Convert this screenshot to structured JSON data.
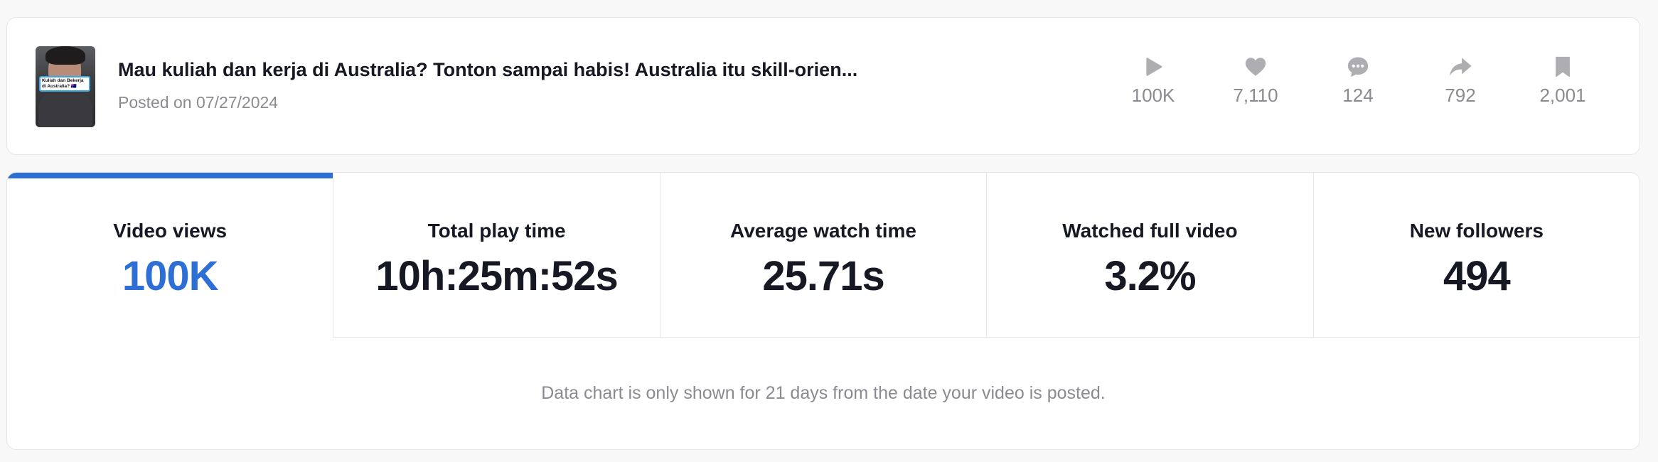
{
  "video": {
    "title": "Mau kuliah dan kerja di Australia? Tonton sampai habis! Australia itu skill-orien...",
    "posted": "Posted on 07/27/2024",
    "thumbnail_caption": "Kuliah dan Bekerja di Australia? 🇦🇺",
    "stats": [
      {
        "icon": "play-icon",
        "value": "100K"
      },
      {
        "icon": "heart-icon",
        "value": "7,110"
      },
      {
        "icon": "comment-icon",
        "value": "124"
      },
      {
        "icon": "share-icon",
        "value": "792"
      },
      {
        "icon": "bookmark-icon",
        "value": "2,001"
      }
    ]
  },
  "metrics": [
    {
      "label": "Video views",
      "value": "100K",
      "active": true
    },
    {
      "label": "Total play time",
      "value": "10h:25m:52s",
      "active": false
    },
    {
      "label": "Average watch time",
      "value": "25.71s",
      "active": false
    },
    {
      "label": "Watched full video",
      "value": "3.2%",
      "active": false
    },
    {
      "label": "New followers",
      "value": "494",
      "active": false
    }
  ],
  "chart_note": "Data chart is only shown for 21 days from the date your video is posted.",
  "colors": {
    "accent": "#2e6fd6",
    "muted_text": "#8a8b91",
    "icon_gray": "#aeaeb2",
    "border": "#e6e6e6"
  }
}
